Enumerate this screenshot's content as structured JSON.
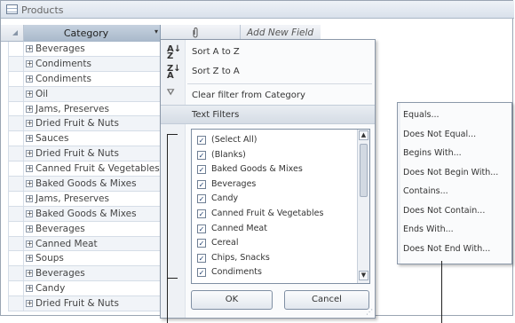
{
  "window": {
    "title": "Products"
  },
  "columns": {
    "category": "Category",
    "add_new_field": "Add New Field"
  },
  "rows": [
    "Beverages",
    "Condiments",
    "Condiments",
    "Oil",
    "Jams, Preserves",
    "Dried Fruit & Nuts",
    "Sauces",
    "Dried Fruit & Nuts",
    "Canned Fruit & Vegetables",
    "Baked Goods & Mixes",
    "Jams, Preserves",
    "Baked Goods & Mixes",
    "Beverages",
    "Canned Meat",
    "Soups",
    "Beverages",
    "Candy",
    "Dried Fruit & Nuts"
  ],
  "filter_menu": {
    "sort_asc": "Sort A to Z",
    "sort_desc": "Sort Z to A",
    "clear_filter": "Clear filter from Category",
    "text_filters": "Text Filters",
    "checklist": [
      {
        "label": "(Select All)",
        "checked": true
      },
      {
        "label": "(Blanks)",
        "checked": true
      },
      {
        "label": "Baked Goods & Mixes",
        "checked": true
      },
      {
        "label": "Beverages",
        "checked": true
      },
      {
        "label": "Candy",
        "checked": true
      },
      {
        "label": "Canned Fruit & Vegetables",
        "checked": true
      },
      {
        "label": "Canned Meat",
        "checked": true
      },
      {
        "label": "Cereal",
        "checked": true
      },
      {
        "label": "Chips, Snacks",
        "checked": true
      },
      {
        "label": "Condiments",
        "checked": true
      }
    ],
    "ok": "OK",
    "cancel": "Cancel"
  },
  "text_filters_submenu": [
    "Equals...",
    "Does Not Equal...",
    "Begins With...",
    "Does Not Begin With...",
    "Contains...",
    "Does Not Contain...",
    "Ends With...",
    "Does Not End With..."
  ],
  "icons": {
    "window_tab": "table-icon",
    "column_dropdown": "dropdown-arrow-icon",
    "attachment": "paperclip-icon",
    "sort_asc": "sort-a-to-z-icon",
    "sort_desc": "sort-z-to-a-icon",
    "clear_filter": "clear-filter-icon",
    "row_expand": "plus-expand-icon"
  },
  "colors": {
    "selected_column_header": "#b4c3d4",
    "menu_highlight": "#dde3ea"
  }
}
